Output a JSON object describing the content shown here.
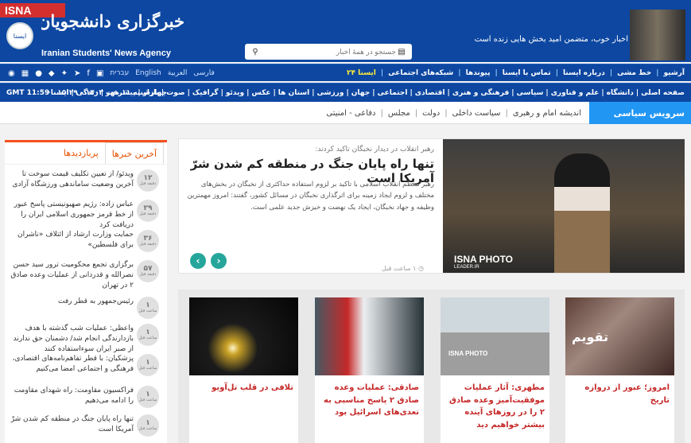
{
  "header": {
    "brand": "ISNA",
    "logo_text": "ایسنا",
    "title_fa": "خبرگزاری دانشجویان ایران، ایسنا",
    "title_en": "Iranian Students' News Agency",
    "slogan": "اخبار خوب، متضمن امید بخش هایی زنده است"
  },
  "search": {
    "placeholder": "جستجو در همهٔ اخبار"
  },
  "top_menu": [
    "آرشیو",
    "خط مشی",
    "درباره ایسنا",
    "تماس با ایسنا",
    "پیوندها",
    "شبکه‌های اجتماعی",
    "ایسنا ۲۴"
  ],
  "languages": [
    "فارسی",
    "العربیة",
    "English",
    "עברית"
  ],
  "social_icons": [
    "rss-icon",
    "windows-icon",
    "android-icon",
    "apple-icon",
    "twitter-icon",
    "telegram-icon",
    "facebook-icon",
    "instagram-icon"
  ],
  "nav": [
    "صفحه اصلی",
    "دانشگاه",
    "علم و فناوری",
    "سیاسی",
    "فرهنگی و هنری",
    "اقتصادی",
    "اجتماعی",
    "جهان",
    "ورزشی",
    "استان ها",
    "عکس",
    "ویدئو",
    "گرافیک",
    "صوت",
    "بازار",
    "پیشرفت",
    "زندگی",
    "ایسنا+"
  ],
  "datetime": {
    "date": "چهارشنبه ۱۱ مهر ۱۴۰۳ - ۱۵:۲۹",
    "gmt": "GMT 11:59"
  },
  "subnav": {
    "service": "سرویس سیاسی",
    "links": [
      "اندیشه امام و رهبری",
      "سیاست داخلی",
      "دولت",
      "مجلس",
      "دفاعی - امنیتی"
    ]
  },
  "sidebar": {
    "tabs": [
      "آخرین خبرها",
      "پربازدیدها"
    ],
    "items": [
      {
        "num": "۱۲",
        "unit": "دقیقه قبل",
        "text": "ویدئو/ از تعیین تکلیف قیمت سوخت تا آخرین وضعیت ساماندهی ورزشگاه آزادی"
      },
      {
        "num": "۲۹",
        "unit": "دقیقه قبل",
        "text": "عباس زاده: رژیم صهیونیستی پاسخ عبور از خط قرمز جمهوری اسلامی ایران را دریافت کرد"
      },
      {
        "num": "۳۶",
        "unit": "دقیقه قبل",
        "text": "حمایت وزارت ارشاد از ائتلاف «ناشران برای فلسطین»"
      },
      {
        "num": "۵۷",
        "unit": "دقیقه قبل",
        "text": "برگزاری تجمع محکومیت ترور سید حسن نصرالله و قدردانی از عملیات وعده صادق ۲ در تهران"
      },
      {
        "num": "۱",
        "unit": "ساعت قبل",
        "text": "رئیس‌جمهور به قطر رفت"
      },
      {
        "num": "۱",
        "unit": "ساعت قبل",
        "text": "واعظی: عملیات شب گذشته با هدف بازدارندگی انجام شد/ دشمنان حق ندارند از صبر ایران سوءاستفاده کنند"
      },
      {
        "num": "۱",
        "unit": "ساعت قبل",
        "text": "پزشکیان: با قطر تفاهم‌نامه‌های اقتصادی، فرهنگی و اجتماعی امضا می‌کنیم"
      },
      {
        "num": "۱",
        "unit": "ساعت قبل",
        "text": "فراکسیون مقاومت: راه شهدای مقاومت را ادامه می‌دهیم"
      },
      {
        "num": "۱",
        "unit": "ساعت قبل",
        "text": "تنها راه پایان جنگ در منطقه کم شدن شرّ آمریکا است"
      }
    ]
  },
  "featured": {
    "supertitle": "رهبر انقلاب در دیدار نخبگان تاکید کردند:",
    "title": "تنها راه پایان جنگ در منطقه کم شدن شرّ آمریکا است",
    "description": "رهبر معظم انقلاب اسلامی با تاکید بر لزوم استفاده حداکثری از نخبگان در بخش‌های مختلف و لزوم ایجاد زمینه برای اثرگذاری نخبگان در مسائل کشور، گفتند: امروز مهمترین وظیفه و جهاد نخبگان، ایجاد یک نهضت و خیزش جدید علمی است.",
    "time": "۱ ساعت قبل",
    "photo_credit": "ISNA PHOTO",
    "photo_sub": "LEADER.IR"
  },
  "cards": [
    {
      "title": "امروز؛ عبور از دروازه تاریخ",
      "overlay": "تقویم"
    },
    {
      "title": "مطهری: آثار عملیات موفقیت‌آمیز وعده صادق ۲ را در روزهای آینده بیشتر خواهیم دید",
      "overlay": "ISNA PHOTO"
    },
    {
      "title": "صادقی: عملیات وعده صادق ۲ پاسخ مناسبی به تعدی‌های اسرائیل بود",
      "overlay": ""
    },
    {
      "title": "تلافی در قلب تل‌آویو",
      "overlay": ""
    }
  ]
}
